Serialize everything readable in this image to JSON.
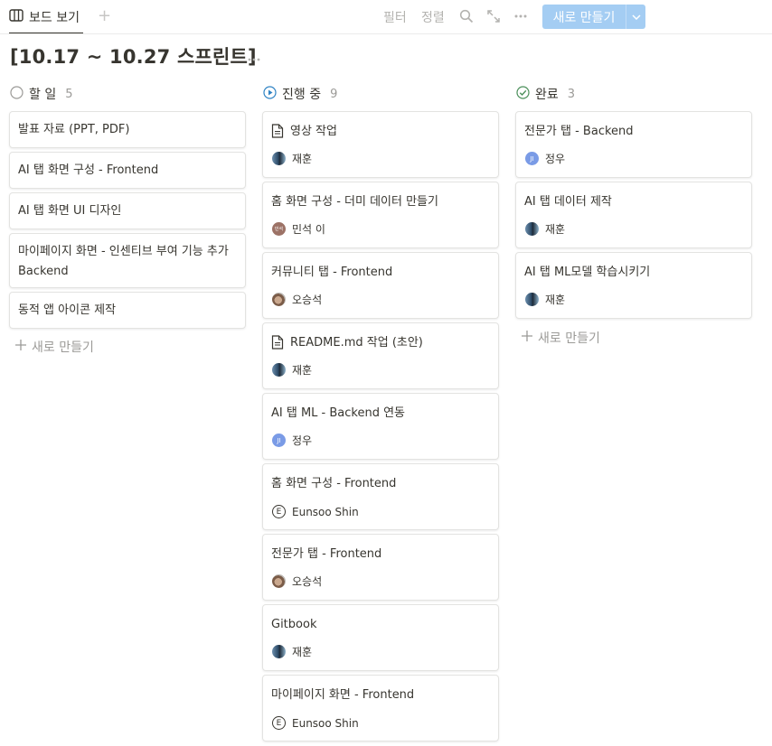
{
  "toolbar": {
    "view_label": "보드 보기",
    "filter": "필터",
    "sort": "정렬",
    "new_button": "새로 만들기"
  },
  "page": {
    "title": "[10.17 ~ 10.27 스프린트]"
  },
  "columns": [
    {
      "name": "할 일",
      "count": "5",
      "cards": [
        {
          "title": "발표 자료 (PPT, PDF)",
          "person": ""
        },
        {
          "title": "AI 탭 화면 구성 - Frontend",
          "person": ""
        },
        {
          "title": "AI 탭 화면 UI 디자인",
          "person": ""
        },
        {
          "title": "마이페이지 화면 - 인센티브 부여 기능 추가 Backend",
          "person": ""
        },
        {
          "title": "동적 앱 아이콘 제작",
          "person": ""
        }
      ],
      "new_label": "새로 만들기"
    },
    {
      "name": "진행 중",
      "count": "9",
      "cards": [
        {
          "title": "영상 작업",
          "person": "재훈"
        },
        {
          "title": "홈 화면 구성 - 더미 데이터 만들기",
          "person": "민석 이",
          "avatar_text": "민석"
        },
        {
          "title": "커뮤니티 탭 - Frontend",
          "person": "오승석"
        },
        {
          "title": "README.md 작업 (초안)",
          "person": "재훈"
        },
        {
          "title": "AI 탭 ML - Backend 연동",
          "person": "정우",
          "avatar_text": "JI"
        },
        {
          "title": "홈 화면 구성 - Frontend",
          "person": "Eunsoo Shin",
          "avatar_text": "E"
        },
        {
          "title": "전문가 탭 - Frontend",
          "person": "오승석"
        },
        {
          "title": "Gitbook",
          "person": "재훈"
        },
        {
          "title": "마이페이지 화면 - Frontend",
          "person": "Eunsoo Shin",
          "avatar_text": "E"
        }
      ]
    },
    {
      "name": "완료",
      "count": "3",
      "cards": [
        {
          "title": "전문가 탭 - Backend",
          "person": "정우",
          "avatar_text": "JI"
        },
        {
          "title": "AI 탭 데이터 제작",
          "person": "재훈"
        },
        {
          "title": "AI 탭 ML모델 학습시키기",
          "person": "재훈"
        }
      ],
      "new_label": "새로 만들기"
    }
  ]
}
